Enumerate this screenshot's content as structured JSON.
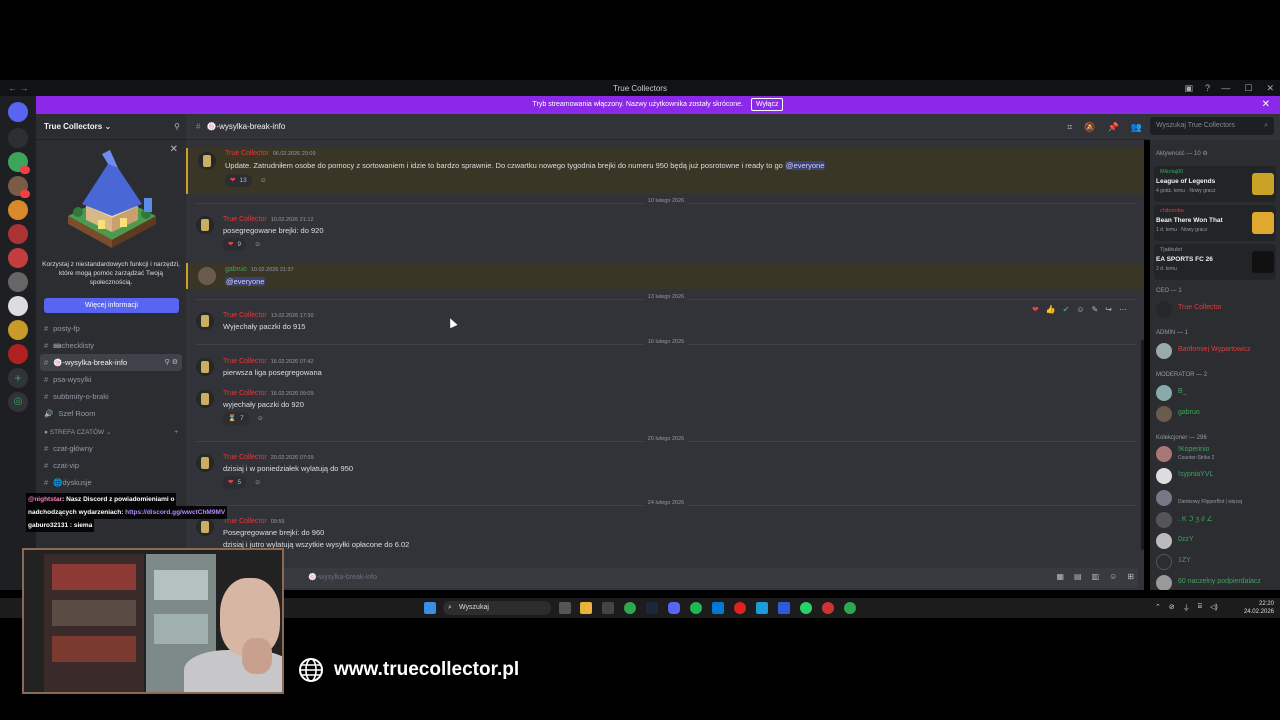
{
  "window": {
    "title": "True Collectors"
  },
  "banner": {
    "text": "Tryb streamowania włączony. Nazwy użytkownika zostały skrócone.",
    "button": "Wyłącz"
  },
  "server": {
    "name": "True Collectors",
    "promo_text": "Korzystaj z niestandardowych funkcji i narzędzi, które mogą pomóc zarządzać Twoją społecznością.",
    "promo_button": "Więcej informacji"
  },
  "channels": [
    {
      "name": "posty-fp"
    },
    {
      "name": "📾checklisty"
    },
    {
      "name": "🍥-wysylka-break-info"
    },
    {
      "name": "psa-wysylki"
    },
    {
      "name": "subbmity-o-braki"
    },
    {
      "name": "Szef Room"
    }
  ],
  "category_chat": "STREFA CZATÓW",
  "chat_channels": [
    {
      "name": "czat-główny"
    },
    {
      "name": "czat-vip"
    },
    {
      "name": "🌐dyskusje"
    },
    {
      "name": "wizualizacja-kolekcji"
    },
    {
      "name": "pokemon"
    }
  ],
  "header": {
    "channel": "🍥-wysylka-break-info",
    "search_placeholder": "Wyszukaj True Collectors"
  },
  "messages": [
    {
      "author": "True Collector",
      "time": "06.02.2026 20:09",
      "text": "Update. Zatrudniłem osobe do pomocy z sortowaniem i idzie to bardzo sprawnie. Do czwartku nowego tygodnia brejki do numeru 950 będą już posrotowne i ready to go",
      "mention": "@everyone",
      "reaction_count": "13"
    },
    {
      "author": "True Collector",
      "time": "10.02.2026 21:12",
      "text": "posegregowane brejki: do 920",
      "reaction_count": "9"
    },
    {
      "author": "gabruo",
      "time": "10.02.2026 21:37",
      "mention": "@everyone"
    },
    {
      "author": "True Collector",
      "time": "13.02.2026 17:30",
      "text": "Wyjechały paczki do 915"
    },
    {
      "author": "True Collector",
      "time": "16.02.2026 07:42",
      "text": "pierwsza liga posegregowana"
    },
    {
      "author": "True Collector",
      "time": "16.02.2026 09:09",
      "text": "wyjechały paczki do 920",
      "reaction_count": "7"
    },
    {
      "author": "True Collector",
      "time": "20.02.2026 07:09",
      "text": "dzisiaj i w poniedziałek wylatują do 950",
      "reaction_count": "5"
    },
    {
      "author": "True Collector",
      "time": "09:59",
      "text": "Posegregowane brejki: do 960",
      "text2": "dzisiaj i jutro wylatują wszytkie wysyłki opłacone do 6.02"
    }
  ],
  "day_dividers": [
    "10 lutego 2026",
    "13 lutego 2026",
    "16 lutego 2026",
    "20 lutego 2026",
    "24 lutego 2026"
  ],
  "composer": {
    "placeholder": "🍥-wysylka-break-info"
  },
  "members": {
    "activity_title": "Aktywność — 10",
    "activities": [
      {
        "user": "Mikolaj00",
        "game": "League of Legends",
        "meta": "4 godz. temu · Nowy gracz"
      },
      {
        "user": "chibombe",
        "game": "Bean There Won That",
        "meta": "1 d. temu · Nowy gracz"
      },
      {
        "user": "Tjakkulot",
        "game": "EA SPORTS FC 26",
        "meta": "2 d. temu"
      }
    ],
    "ceo_title": "CEO — 1",
    "ceo": "True Collector",
    "admin_title": "ADMIN — 1",
    "admin": "Bartłomiej Wypartowicz",
    "mod_title": "MODERATOR — 2",
    "mods": [
      "B_",
      "gabruo"
    ],
    "collector_title": "Kolekcjoner — 296",
    "collectors": [
      {
        "name": "!Koperinio",
        "sub": "Counter-Strike 2"
      },
      {
        "name": "!sypniaYVL",
        "sub": ""
      },
      {
        "name": "",
        "sub": "Damkowy FlipperBot | więcej"
      },
      {
        "name": ". K ℑ ʒ ∂ ∠",
        "sub": ""
      },
      {
        "name": "0zzY",
        "sub": ""
      },
      {
        "name": "1ZY",
        "sub": ""
      },
      {
        "name": "60 naczelny podpierdalacz",
        "sub": ""
      }
    ]
  },
  "taskbar": {
    "search": "Wyszukaj",
    "time": "22:20",
    "date": "24.02.2026"
  },
  "overlay": {
    "line1_user": "@nightstar",
    "line1": ": Nasz Discord z powiadomieniami o",
    "line2": "nadchodzących wydarzeniach: ",
    "line2_link": "https://discord.gg/wwctChM9MV",
    "line3": "gaburo32131 : siema"
  },
  "footer_url": "www.truecollector.pl"
}
